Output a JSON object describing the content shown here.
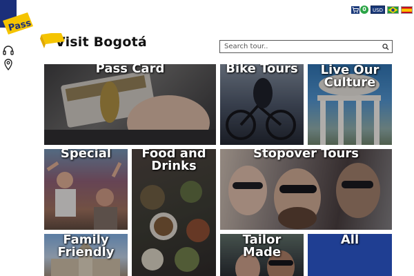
{
  "header": {
    "site_title": "Visit Bogotá",
    "rail_logo_text": "Pass",
    "cart_count": "0",
    "currency": "USD"
  },
  "search": {
    "placeholder": "Search tour.."
  },
  "tiles": [
    {
      "label": "Pass Card"
    },
    {
      "label": "Bike Tours"
    },
    {
      "label": "Live Our Culture"
    },
    {
      "label": "Special"
    },
    {
      "label": "Food and Drinks"
    },
    {
      "label": "Stopover Tours"
    },
    {
      "label": "Family Friendly"
    },
    {
      "label": "Tailor Made"
    },
    {
      "label": "All"
    }
  ],
  "colors": {
    "brand_yellow": "#f5c400",
    "brand_blue": "#1f3e92",
    "cart_green": "#2ba446"
  },
  "icons": {
    "rail": [
      "headphones-icon",
      "location-pin-icon"
    ],
    "search": "search-icon",
    "cart": "cart-icon",
    "flags": [
      "brazil-flag-icon",
      "spain-flag-icon"
    ]
  }
}
